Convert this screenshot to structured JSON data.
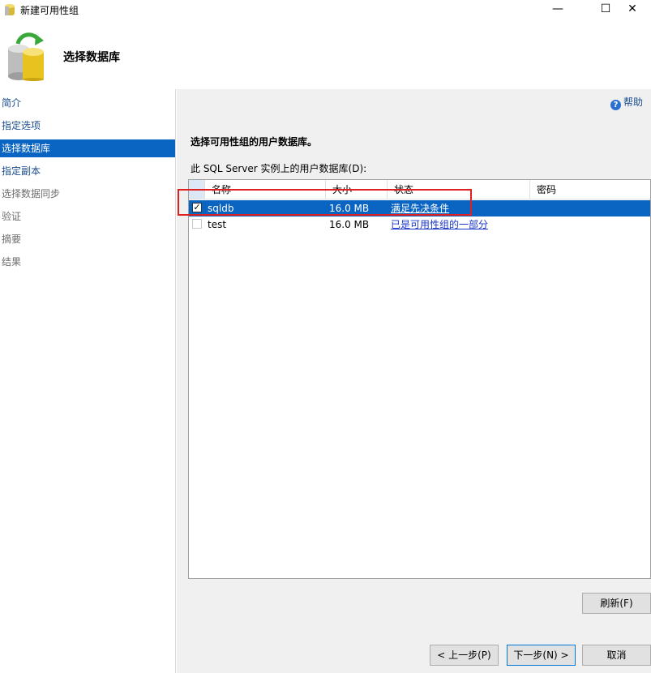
{
  "window": {
    "title": "新建可用性组",
    "minimize": "—",
    "maximize": "☐",
    "close": "✕"
  },
  "header": {
    "title": "选择数据库"
  },
  "sidebar": {
    "items": [
      {
        "label": "简介",
        "state": "link"
      },
      {
        "label": "指定选项",
        "state": "link"
      },
      {
        "label": "选择数据库",
        "state": "selected"
      },
      {
        "label": "指定副本",
        "state": "link"
      },
      {
        "label": "选择数据同步",
        "state": "disabled"
      },
      {
        "label": "验证",
        "state": "disabled"
      },
      {
        "label": "摘要",
        "state": "disabled"
      },
      {
        "label": "结果",
        "state": "disabled"
      }
    ]
  },
  "main": {
    "help": "帮助",
    "instruction": "选择可用性组的用户数据库。",
    "grid_label": "此 SQL Server 实例上的用户数据库(D):",
    "columns": [
      "名称",
      "大小",
      "状态",
      "密码"
    ],
    "rows": [
      {
        "checked": true,
        "name": "sqldb",
        "size": "16.0 MB",
        "status": "满足先决条件",
        "password": ""
      },
      {
        "checked": false,
        "name": "test",
        "size": "16.0 MB",
        "status": "已是可用性组的一部分",
        "password": ""
      }
    ],
    "refresh_button": "刷新(F)"
  },
  "footer": {
    "prev_button": "< 上一步(P)",
    "next_button": "下一步(N) >",
    "cancel_button": "取消"
  },
  "colors": {
    "accent": "#0a64c2",
    "link": "#1a4d8f",
    "highlight_box": "#e02020"
  }
}
